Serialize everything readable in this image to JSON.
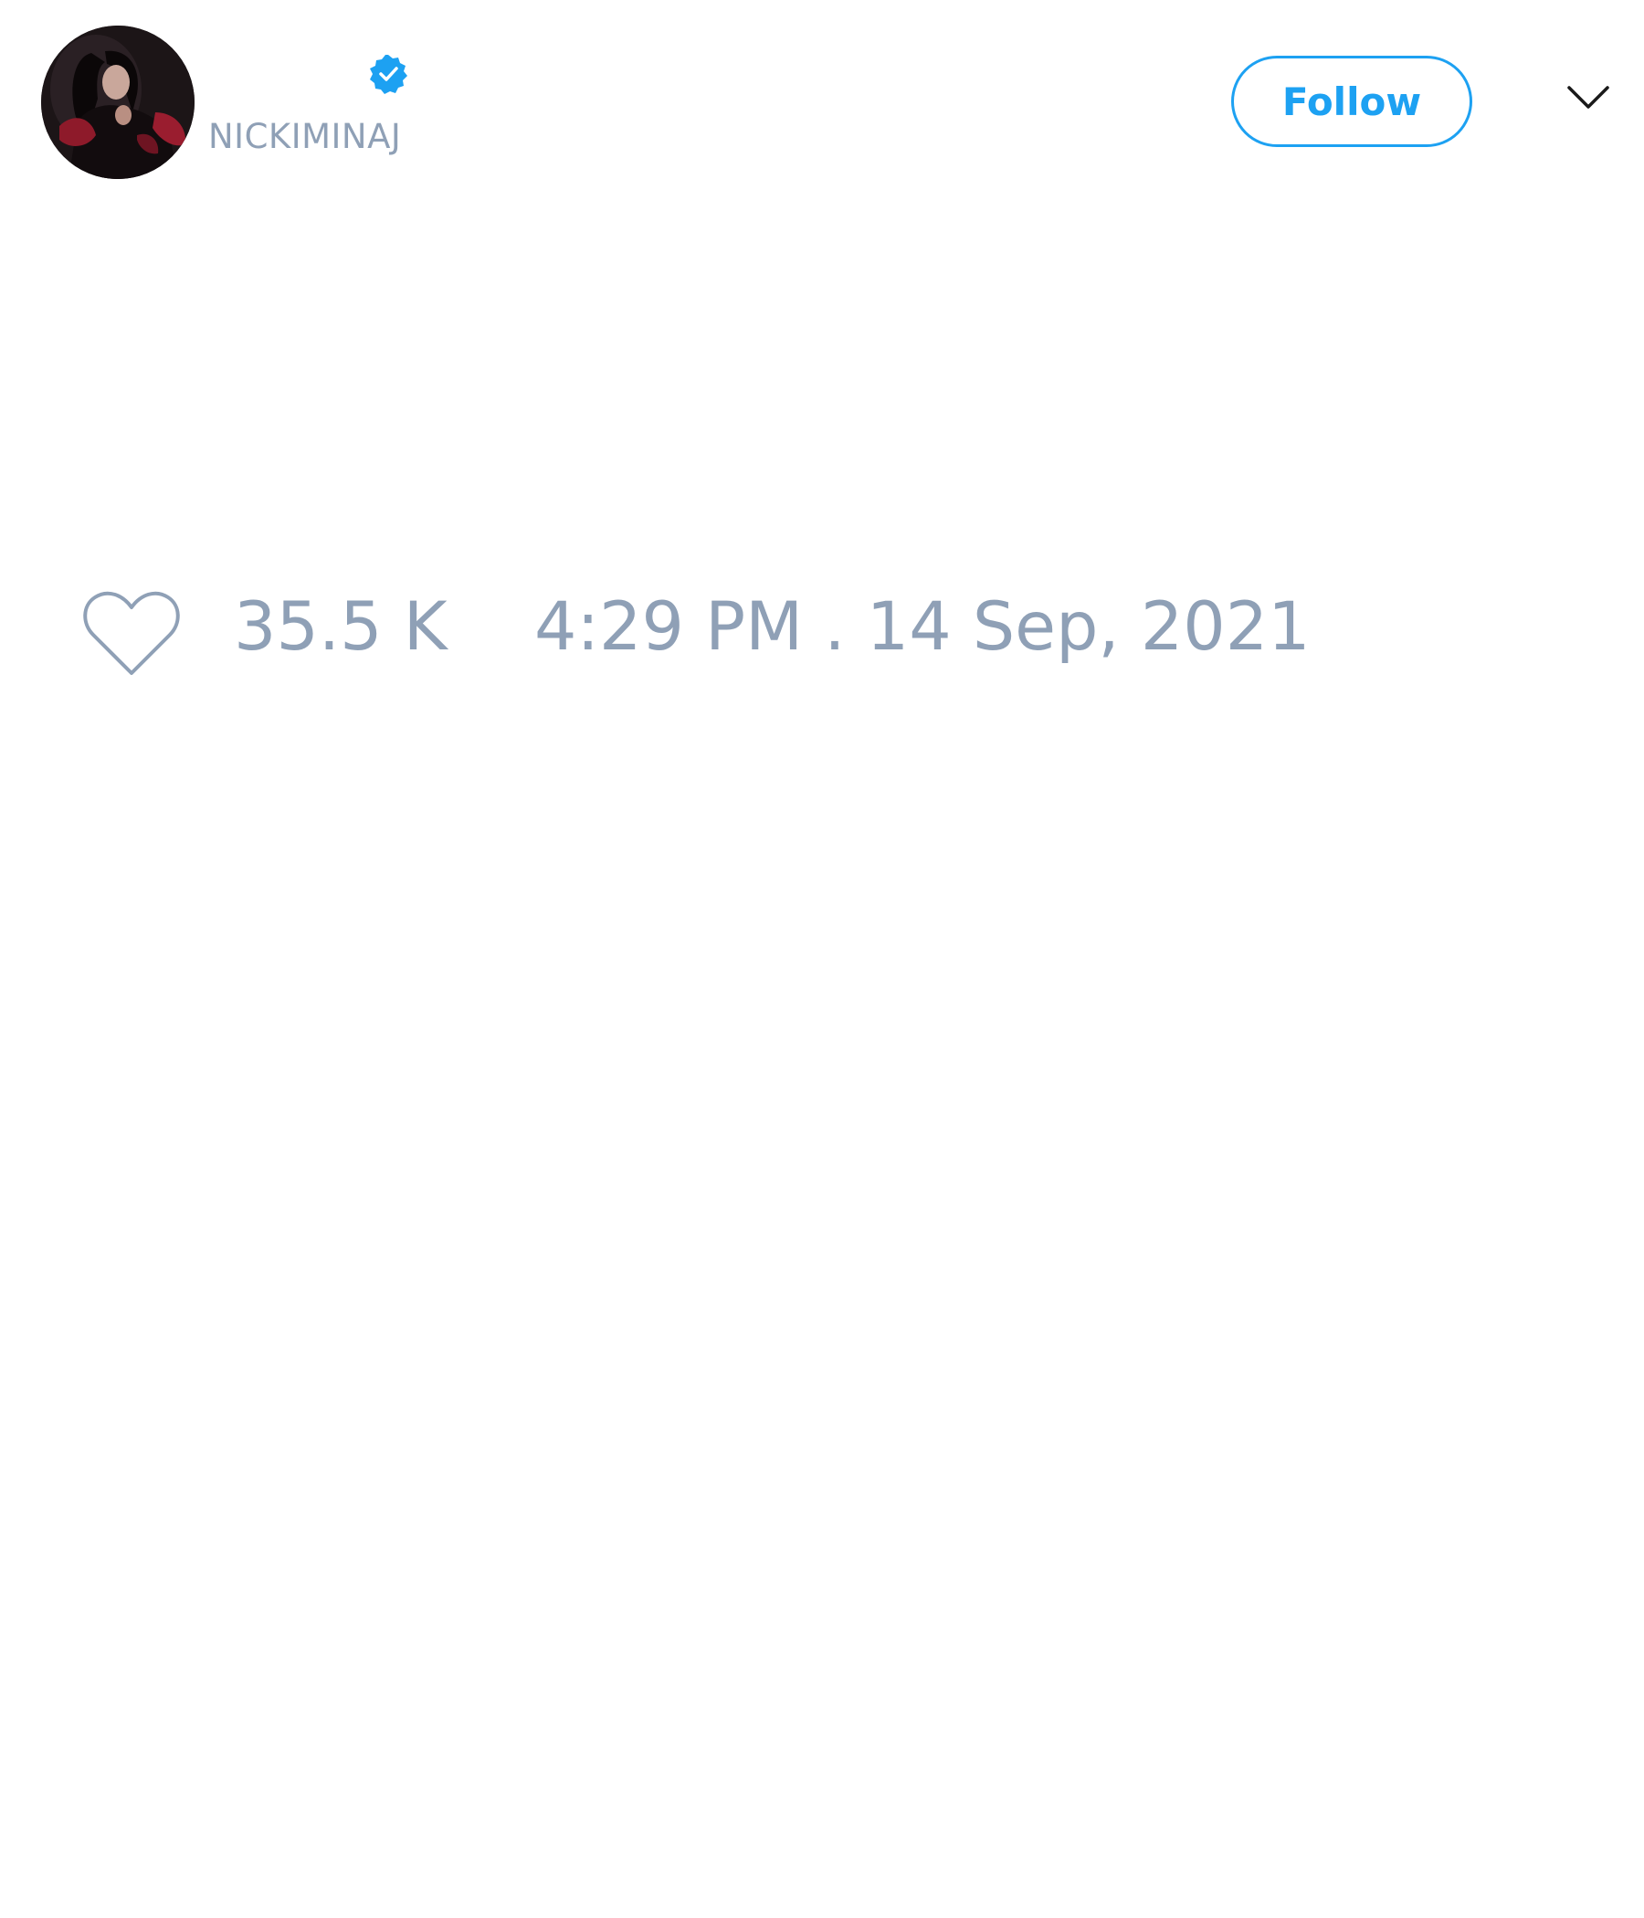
{
  "tweet": {
    "author": {
      "handle": "NICKIMINAJ",
      "verified": true,
      "avatar_icon": "profile-photo"
    },
    "follow_label": "Follow",
    "more_icon": "chevron-down-icon",
    "stats": {
      "like_icon": "heart-icon",
      "likes": "35.5 K",
      "timestamp": "4:29 PM . 14 Sep, 2021"
    }
  },
  "colors": {
    "accent": "#1da1f2",
    "muted_text": "#8fa0b6",
    "background": "#ffffff"
  }
}
